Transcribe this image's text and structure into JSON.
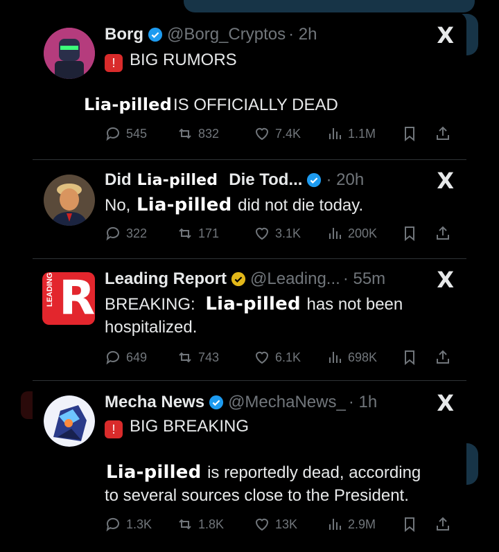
{
  "tweets": [
    {
      "name": "Borg",
      "handle": "@Borg_Cryptos",
      "time": "· 2h",
      "verified_color": "#1d9bf0",
      "avatar_icon": "robot-avatar",
      "headline": "BIG RUMORS",
      "censor": "Lia-pilled",
      "body": "IS OFFICIALLY DEAD",
      "replies": "545",
      "reposts": "832",
      "likes": "7.4K",
      "views": "1.1M"
    },
    {
      "name_pre": "Did",
      "censor_name": "Lia-pilled",
      "name_post": "Die Tod...",
      "time": "· 20h",
      "verified_color": "#1d9bf0",
      "avatar_icon": "person-avatar",
      "text_pre": "No,",
      "censor": "Lia-pilled",
      "text_post": "did not die today.",
      "replies": "322",
      "reposts": "171",
      "likes": "3.1K",
      "views": "200K"
    },
    {
      "name": "Leading Report",
      "handle": "@Leading...",
      "time": "· 55m",
      "verified_color": "#e2b719",
      "avatar_icon": "leading-report-logo",
      "logo_side_text": "LEADING",
      "logo_letter": "R",
      "text_pre": "BREAKING:",
      "censor": "Lia-pilled",
      "text_post": "has not been",
      "text_line2": "hospitalized.",
      "replies": "649",
      "reposts": "743",
      "likes": "6.1K",
      "views": "698K"
    },
    {
      "name": "Mecha News",
      "handle": "@MechaNews_",
      "time": "· 1h",
      "verified_color": "#1d9bf0",
      "avatar_icon": "mecha-avatar",
      "headline": "BIG BREAKING",
      "censor": "Lia-pilled",
      "text_post": "is reportedly dead, according",
      "text_line2": "to several sources close to the President.",
      "replies": "1.3K",
      "reposts": "1.8K",
      "likes": "13K",
      "views": "2.9M"
    }
  ],
  "icons": {
    "close": "X",
    "siren": "🚨"
  }
}
